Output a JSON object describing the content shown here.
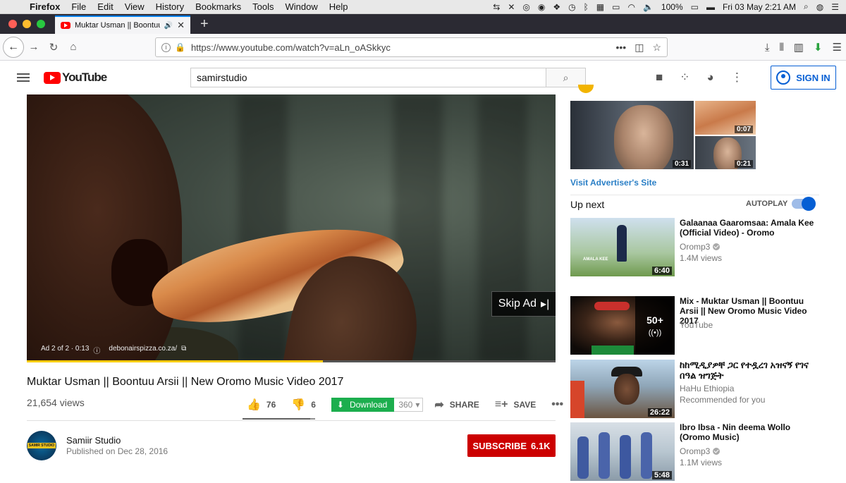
{
  "menubar": {
    "app": "Firefox",
    "items": [
      "File",
      "Edit",
      "View",
      "History",
      "Bookmarks",
      "Tools",
      "Window",
      "Help"
    ],
    "battery": "100%",
    "clock": "Fri 03 May  2:21 AM"
  },
  "tab": {
    "title": "Muktar Usman || Boontuu Arsii",
    "close": "✕",
    "new": "+"
  },
  "browser": {
    "url": "https://www.youtube.com/watch?v=aLn_oASkkyc"
  },
  "youtube": {
    "logo_text": "YouTube",
    "search_value": "samirstudio",
    "signin_label": "SIGN IN"
  },
  "player": {
    "skip_label": "Skip Ad",
    "ad_info": "Ad 2 of 2 · 0:13",
    "ad_url": "debonairspizza.co.za/",
    "progress": 0.56
  },
  "video": {
    "title": "Muktar Usman || Boontuu Arsii || New Oromo Music Video 2017",
    "views": "21,654 views",
    "likes": "76",
    "dislikes": "6",
    "download_label": "Download",
    "quality": "360",
    "share_label": "SHARE",
    "save_label": "SAVE",
    "channel": "Samiir Studio",
    "channel_avatar_text": "SAMIR STUDIO",
    "published": "Published on Dec 28, 2016",
    "subscribe_label": "SUBSCRIBE",
    "subscribers": "6.1K",
    "like_ratio": 0.93
  },
  "sidebar": {
    "ad_durations": [
      "0:31",
      "0:07",
      "0:21"
    ],
    "advertiser_link": "Visit Advertiser's Site",
    "up_next": "Up next",
    "autoplay": "AUTOPLAY",
    "videos": [
      {
        "title": "Galaanaa Gaaromsaa: Amala Kee (Official Video) - Oromo",
        "channel": "Oromp3",
        "meta": "1.4M views",
        "duration": "6:40",
        "verified": true,
        "thumb_text": "AMALA KEE"
      },
      {
        "title": "Mix - Muktar Usman || Boontuu Arsii || New Oromo Music Video 2017",
        "channel": "YouTube",
        "meta": "",
        "duration": "",
        "badge": "50+"
      },
      {
        "title": "ከከሚዲያዎቸ ጋር የተዷረገ አዝናኝ የገና በዓል ዝግጅት",
        "channel": "HaHu Ethiopia",
        "meta": "Recommended for you",
        "duration": "26:22"
      },
      {
        "title": "Ibro Ibsa - Nin deema Wollo (Oromo Music)",
        "channel": "Oromp3",
        "meta": "1.1M views",
        "duration": "5:48",
        "verified": true
      }
    ]
  },
  "colors": {
    "youtube_red": "#ff0000",
    "link_blue": "#065fd4",
    "download_green": "#1cae4e",
    "subscribe_red": "#cc0000",
    "progress_yellow": "#ffcc00"
  }
}
